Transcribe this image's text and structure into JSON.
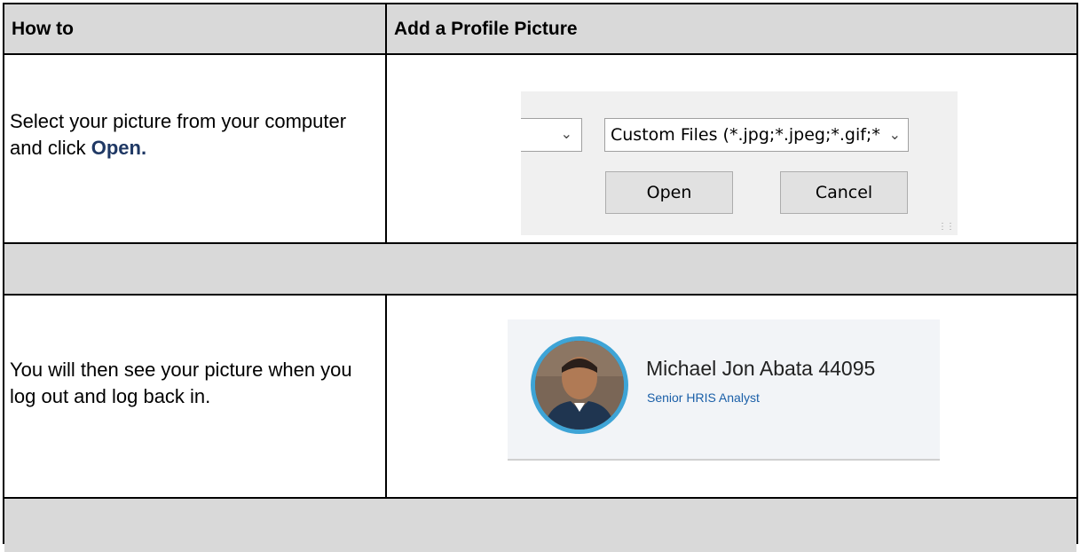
{
  "header": {
    "col1": "How to",
    "col2": "Add a Profile Picture"
  },
  "steps": [
    {
      "text_before": "Select your picture from your computer and click ",
      "text_bold": "Open.",
      "dialog": {
        "file_type_combo": "Custom Files (*.jpg;*.jpeg;*.gif;*",
        "open_button": "Open",
        "cancel_button": "Cancel"
      }
    },
    {
      "text": "You will then see your picture when you log out and log back in.",
      "profile": {
        "name": "Michael Jon Abata 44095",
        "title": "Senior HRIS Analyst"
      }
    }
  ],
  "colors": {
    "header_bg": "#d9d9d9",
    "link_bold": "#1f3864",
    "avatar_ring": "#3ea4d6",
    "role_text": "#1a5fa8"
  }
}
